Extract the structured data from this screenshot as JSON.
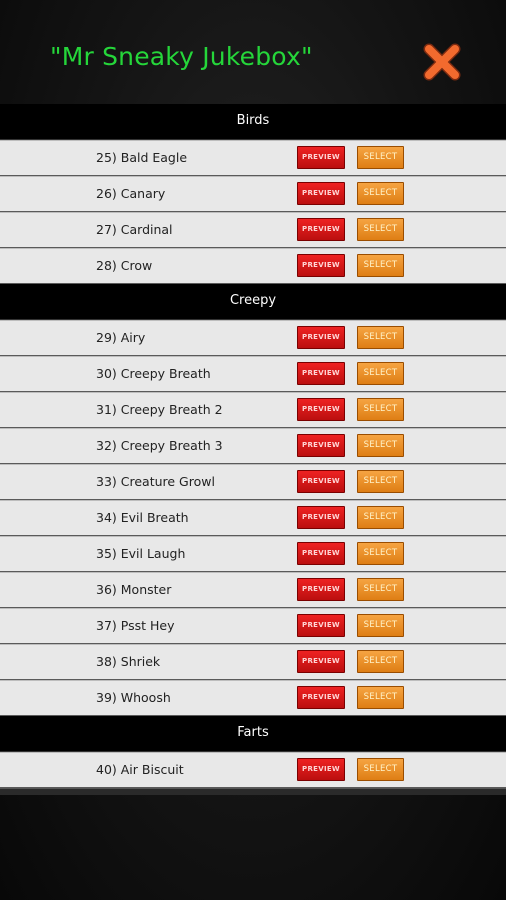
{
  "header": {
    "title": "\"Mr Sneaky Jukebox\"",
    "close_icon": "close-x-icon"
  },
  "colors": {
    "title": "#25d63a",
    "preview": "#dd1a1a",
    "select": "#f0962e",
    "close": "#f26a2e"
  },
  "buttons": {
    "preview_label": "PREVIEW",
    "select_label": "SELECT"
  },
  "sections": [
    {
      "title": "Birds",
      "items": [
        "25) Bald Eagle",
        "26) Canary",
        "27) Cardinal",
        "28) Crow"
      ]
    },
    {
      "title": "Creepy",
      "items": [
        "29) Airy",
        "30) Creepy Breath",
        "31) Creepy Breath 2",
        "32) Creepy Breath 3",
        "33) Creature Growl",
        "34) Evil Breath",
        "35) Evil Laugh",
        "36) Monster",
        "37) Psst Hey",
        "38) Shriek",
        "39) Whoosh"
      ]
    },
    {
      "title": "Farts",
      "items": [
        "40) Air Biscuit"
      ]
    }
  ]
}
